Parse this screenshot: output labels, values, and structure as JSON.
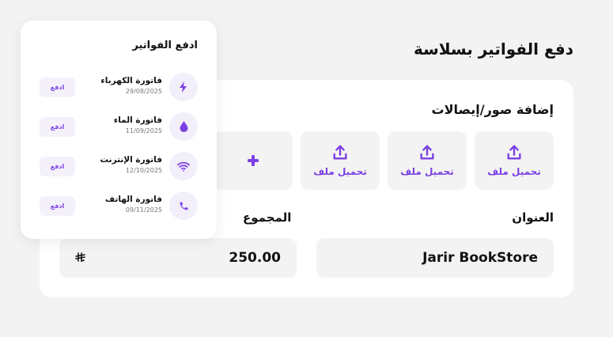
{
  "page": {
    "title": "دفع الفواتير بسلاسة"
  },
  "uploads": {
    "section_title": "إضافة صور/إيصالات",
    "tiles": [
      {
        "label": "تحميل ملف",
        "icon": "upload-icon"
      },
      {
        "label": "تحميل ملف",
        "icon": "upload-icon"
      },
      {
        "label": "تحميل ملف",
        "icon": "upload-icon"
      }
    ],
    "add_icon": "plus-icon"
  },
  "form": {
    "address_label": "العنوان",
    "address_value": "Jarir BookStore",
    "total_label": "المجموع",
    "total_value": "250.00",
    "currency_symbol": "⃁"
  },
  "bills": {
    "title": "ادفع الفواتير",
    "pay_label": "ادفع",
    "items": [
      {
        "name": "فاتورة الكهرباء",
        "date": "29/08/2025",
        "icon": "lightning-icon"
      },
      {
        "name": "فاتورة الماء",
        "date": "11/09/2025",
        "icon": "water-drop-icon"
      },
      {
        "name": "فاتورة الإنترنت",
        "date": "12/10/2025",
        "icon": "wifi-icon"
      },
      {
        "name": "فاتورة الهاتف",
        "date": "09/11/2025",
        "icon": "phone-icon"
      }
    ]
  },
  "colors": {
    "accent": "#7b3fe4",
    "background": "#f3f3f3",
    "card": "#ffffff",
    "icon_bg": "#f2eefa"
  }
}
